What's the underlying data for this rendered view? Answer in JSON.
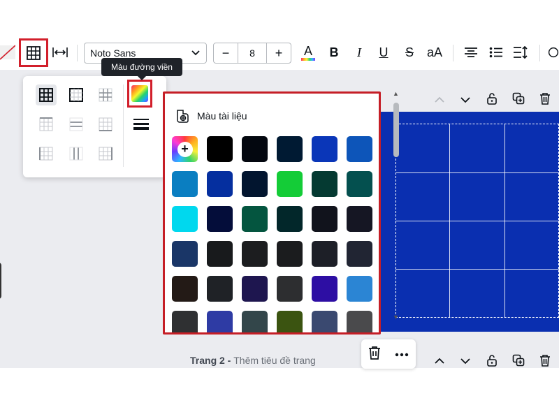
{
  "toolbar": {
    "font_family": "Noto Sans",
    "font_size": "8",
    "minus_label": "−",
    "plus_label": "+",
    "case_label": "aA",
    "bold_label": "B",
    "italic_label": "I",
    "underline_label": "U",
    "strike_label": "S"
  },
  "tooltip": {
    "text": "Màu đường viền"
  },
  "color_panel": {
    "header": "Màu tài liệu",
    "add_label": "+",
    "swatches": [
      "#000000",
      "#03070f",
      "#001a33",
      "#0a36b8",
      "#0d55b9",
      "#0a7ec1",
      "#052f9f",
      "#02152f",
      "#14cc37",
      "#053a32",
      "#04504f",
      "#00d8ee",
      "#040d3a",
      "#04553f",
      "#02272a",
      "#11131c",
      "#151623",
      "#1a3667",
      "#181a1c",
      "#1c1d1f",
      "#1b1c1e",
      "#1d1f27",
      "#212533",
      "#231a16",
      "#1f2226",
      "#1e164f",
      "#2d2e30",
      "#2d0ea3",
      "#2b85d4",
      "#2f3032",
      "#2e3ba4",
      "#33464a",
      "#3b5411",
      "#3a4970",
      "#4a4a4c"
    ]
  },
  "page": {
    "label_bold": "Trang 2 - ",
    "label_sub": "Thêm tiêu đề trang"
  },
  "colors": {
    "highlight_frame": "#d21f2b",
    "design_background": "#0a2fb0",
    "workspace": "#ebecf0"
  }
}
